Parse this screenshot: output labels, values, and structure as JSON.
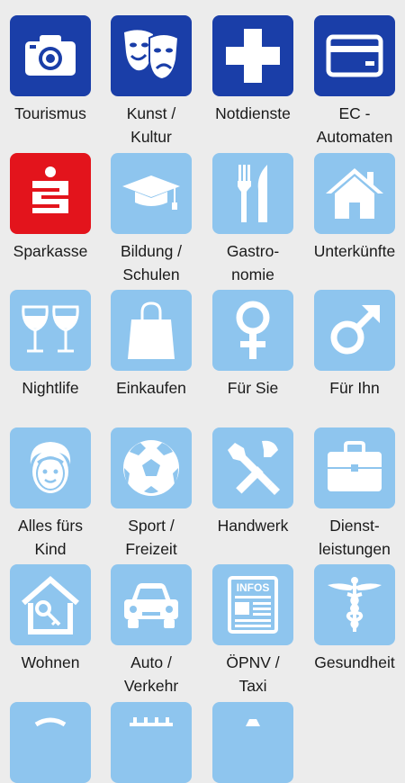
{
  "colors": {
    "dark_blue": "#1a3ea8",
    "light_blue": "#8ec5ee",
    "sparkasse_red": "#e3141c",
    "background": "#ececec"
  },
  "tiles": [
    {
      "label": "Tourismus",
      "icon": "camera-icon",
      "color": "dark_blue"
    },
    {
      "label": "Kunst /\nKultur",
      "icon": "theater-masks-icon",
      "color": "dark_blue"
    },
    {
      "label": "Notdienste",
      "icon": "medical-cross-icon",
      "color": "dark_blue"
    },
    {
      "label": "EC -\nAutomaten",
      "icon": "credit-card-icon",
      "color": "dark_blue"
    },
    {
      "label": "Sparkasse",
      "icon": "sparkasse-logo-icon",
      "color": "sparkasse_red"
    },
    {
      "label": "Bildung /\nSchulen",
      "icon": "graduation-cap-icon",
      "color": "light_blue"
    },
    {
      "label": "Gastro-\nnomie",
      "icon": "fork-knife-icon",
      "color": "light_blue"
    },
    {
      "label": "Unterkünfte",
      "icon": "house-icon",
      "color": "light_blue"
    },
    {
      "label": "Nightlife",
      "icon": "wine-glasses-icon",
      "color": "light_blue"
    },
    {
      "label": "Einkaufen",
      "icon": "shopping-bag-icon",
      "color": "light_blue"
    },
    {
      "label": "Für Sie",
      "icon": "female-symbol-icon",
      "color": "light_blue"
    },
    {
      "label": "Für Ihn",
      "icon": "male-symbol-icon",
      "color": "light_blue"
    },
    {
      "label": "Alles fürs\nKind",
      "icon": "child-face-icon",
      "color": "light_blue"
    },
    {
      "label": "Sport /\nFreizeit",
      "icon": "soccer-ball-icon",
      "color": "light_blue"
    },
    {
      "label": "Handwerk",
      "icon": "wrench-screwdriver-icon",
      "color": "light_blue"
    },
    {
      "label": "Dienst-\nleistungen",
      "icon": "briefcase-icon",
      "color": "light_blue"
    },
    {
      "label": "Wohnen",
      "icon": "house-key-icon",
      "color": "light_blue"
    },
    {
      "label": "Auto /\nVerkehr",
      "icon": "car-icon",
      "color": "light_blue"
    },
    {
      "label": "ÖPNV /\nTaxi",
      "icon": "infos-board-icon",
      "color": "light_blue",
      "icon_text": "INFOS"
    },
    {
      "label": "Gesundheit",
      "icon": "caduceus-icon",
      "color": "light_blue"
    },
    {
      "label": "",
      "icon": "partial-icon",
      "color": "light_blue"
    },
    {
      "label": "",
      "icon": "partial-icon",
      "color": "light_blue"
    },
    {
      "label": "",
      "icon": "partial-icon",
      "color": "light_blue"
    }
  ]
}
